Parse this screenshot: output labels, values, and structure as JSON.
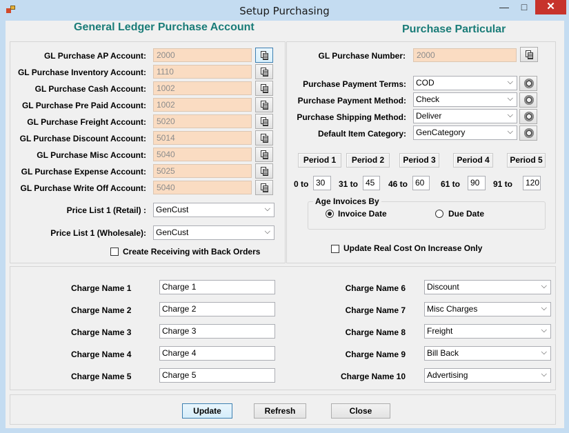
{
  "window": {
    "title": "Setup Purchasing",
    "minimize": "—",
    "maximize": "□",
    "close": "✕"
  },
  "gl": {
    "heading": "General Ledger Purchase Account",
    "rows": [
      {
        "label": "GL Purchase AP Account:",
        "value": "2000"
      },
      {
        "label": "GL Purchase Inventory Account:",
        "value": "1110"
      },
      {
        "label": "GL Purchase Cash Account:",
        "value": "1002"
      },
      {
        "label": "GL Purchase Pre Paid Account:",
        "value": "1002"
      },
      {
        "label": "GL Purchase Freight Account:",
        "value": "5020"
      },
      {
        "label": "GL Purchase Discount Account:",
        "value": "5014"
      },
      {
        "label": "GL Purchase Misc Account:",
        "value": "5040"
      },
      {
        "label": "GL Purchase Expense Account:",
        "value": "5025"
      },
      {
        "label": "GL Purchase Write Off Account:",
        "value": "5040"
      }
    ],
    "price_retail_label": "Price List 1 (Retail) :",
    "price_retail_value": "GenCust",
    "price_wholesale_label": "Price List 1 (Wholesale):",
    "price_wholesale_value": "GenCust",
    "back_orders_label": "Create Receiving with Back Orders",
    "back_orders_checked": false
  },
  "particular": {
    "heading": "Purchase Particular",
    "number_label": "GL Purchase Number:",
    "number_value": "2000",
    "terms_label": "Purchase Payment Terms:",
    "terms_value": "COD",
    "method_label": "Purchase Payment Method:",
    "method_value": "Check",
    "shipping_label": "Purchase Shipping Method:",
    "shipping_value": "Deliver",
    "category_label": "Default Item Category:",
    "category_value": "GenCategory",
    "periods": [
      {
        "title": "Period 1",
        "from": "0 to",
        "to": "30"
      },
      {
        "title": "Period 2",
        "from": "31 to",
        "to": "45"
      },
      {
        "title": "Period 3",
        "from": "46 to",
        "to": "60"
      },
      {
        "title": "Period 4",
        "from": "61 to",
        "to": "90"
      },
      {
        "title": "Period 5",
        "from": "91 to",
        "to": "120"
      }
    ],
    "age_title": "Age Invoices By",
    "age_invoice_date": "Invoice Date",
    "age_due_date": "Due Date",
    "age_selected": "Invoice Date",
    "real_cost_label": "Update Real Cost On Increase Only",
    "real_cost_checked": false
  },
  "charges": {
    "left": [
      {
        "label": "Charge Name 1",
        "value": "Charge 1"
      },
      {
        "label": "Charge Name 2",
        "value": "Charge 2"
      },
      {
        "label": "Charge Name 3",
        "value": "Charge 3"
      },
      {
        "label": "Charge Name 4",
        "value": "Charge 4"
      },
      {
        "label": "Charge Name 5",
        "value": "Charge 5"
      }
    ],
    "right": [
      {
        "label": "Charge Name 6",
        "value": "Discount"
      },
      {
        "label": "Charge Name 7",
        "value": "Misc Charges"
      },
      {
        "label": "Charge Name 8",
        "value": "Freight"
      },
      {
        "label": "Charge Name 9",
        "value": "Bill Back"
      },
      {
        "label": "Charge Name 10",
        "value": "Advertising"
      }
    ]
  },
  "buttons": {
    "update": "Update",
    "refresh": "Refresh",
    "close": "Close"
  },
  "colors": {
    "accent_heading": "#1a7c78",
    "readonly_field": "#fadcc2",
    "close_button": "#c7332c",
    "frame": "#c4dcf1"
  }
}
